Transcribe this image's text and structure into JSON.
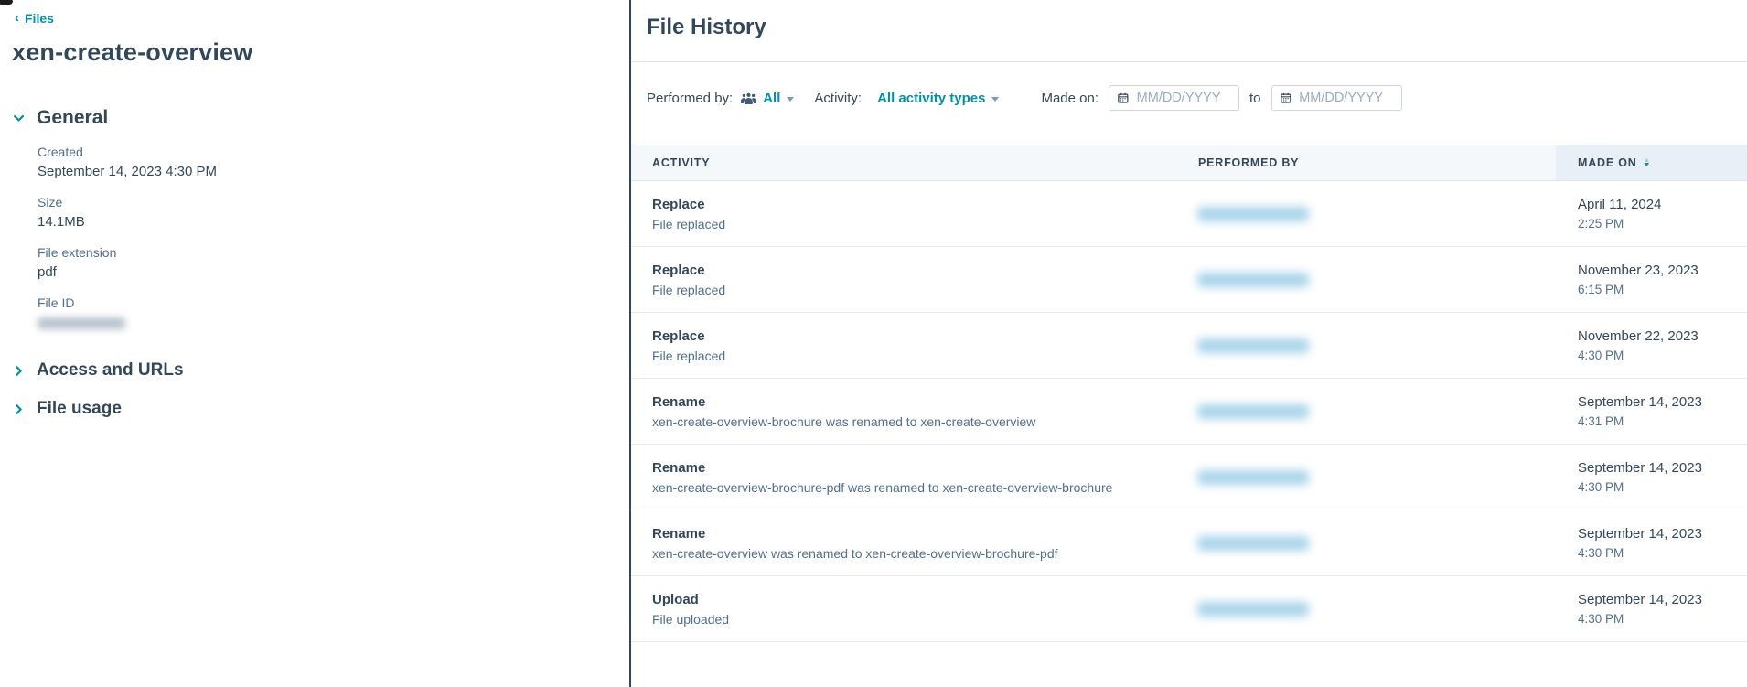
{
  "sidebar": {
    "breadcrumb": {
      "label": "Files"
    },
    "page_title": "xen-create-overview",
    "general": {
      "label": "General",
      "expanded": true,
      "fields": [
        {
          "label": "Created",
          "value": "September 14, 2023 4:30 PM"
        },
        {
          "label": "Size",
          "value": "14.1MB"
        },
        {
          "label": "File extension",
          "value": "pdf"
        },
        {
          "label": "File ID",
          "value": "",
          "redacted": true
        }
      ]
    },
    "collapsed_sections": [
      {
        "label": "Access and URLs"
      },
      {
        "label": "File usage"
      }
    ]
  },
  "main": {
    "title": "File History",
    "filters": {
      "performed_by": {
        "label": "Performed by:",
        "value": "All"
      },
      "activity": {
        "label": "Activity:",
        "value": "All activity types"
      },
      "made_on": {
        "label": "Made on:",
        "from_placeholder": "MM/DD/YYYY",
        "separator": "to",
        "to_placeholder": "MM/DD/YYYY"
      }
    },
    "table": {
      "headers": [
        {
          "label": "ACTIVITY"
        },
        {
          "label": "PERFORMED BY"
        },
        {
          "label": "MADE ON",
          "sorted": "descending"
        }
      ],
      "rows": [
        {
          "activity": "Replace",
          "description": "File replaced",
          "performed_by_redacted": true,
          "date": "April 11, 2024",
          "time": "2:25 PM"
        },
        {
          "activity": "Replace",
          "description": "File replaced",
          "performed_by_redacted": true,
          "date": "November 23, 2023",
          "time": "6:15 PM"
        },
        {
          "activity": "Replace",
          "description": "File replaced",
          "performed_by_redacted": true,
          "date": "November 22, 2023",
          "time": "4:30 PM"
        },
        {
          "activity": "Rename",
          "description": "xen-create-overview-brochure was renamed to xen-create-overview",
          "performed_by_redacted": true,
          "date": "September 14, 2023",
          "time": "4:31 PM"
        },
        {
          "activity": "Rename",
          "description": "xen-create-overview-brochure-pdf was renamed to xen-create-overview-brochure",
          "performed_by_redacted": true,
          "date": "September 14, 2023",
          "time": "4:30 PM"
        },
        {
          "activity": "Rename",
          "description": "xen-create-overview was renamed to xen-create-overview-brochure-pdf",
          "performed_by_redacted": true,
          "date": "September 14, 2023",
          "time": "4:30 PM"
        },
        {
          "activity": "Upload",
          "description": "File uploaded",
          "performed_by_redacted": true,
          "date": "September 14, 2023",
          "time": "4:30 PM"
        }
      ]
    }
  },
  "colors": {
    "link_teal": "#0091ae",
    "text_dark": "#33475b",
    "text_secondary": "#516f90",
    "table_header_bg": "#f5f8fa",
    "sorted_column_header_bg": "#e9eff6",
    "row_border": "#e6ebf2",
    "input_border": "#cbd6e2",
    "placeholder_text": "#99acc2",
    "panel_divider": "#33475b",
    "redacted_name_blue": "#a8d4ea",
    "redacted_id_gray": "#b9c3cf"
  }
}
